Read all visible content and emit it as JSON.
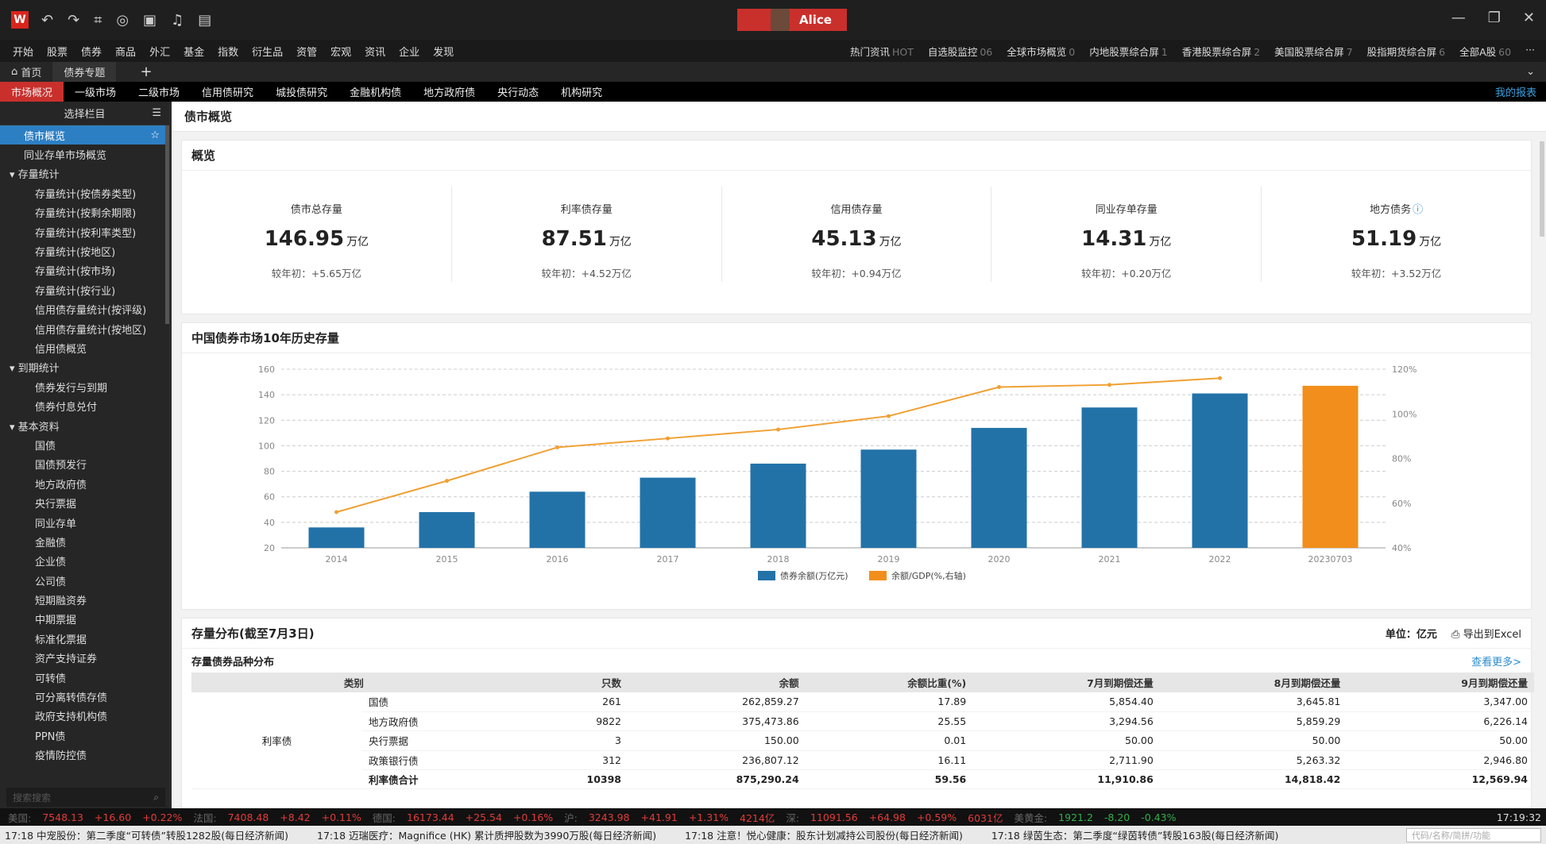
{
  "window": {
    "user_name": "Alice",
    "logo": "W",
    "time": "17:19:32"
  },
  "toolbar_icons": [
    "undo-icon",
    "redo-icon",
    "crop-icon",
    "chat-icon",
    "layout-icon",
    "bell-icon",
    "note-icon"
  ],
  "menu": {
    "left": [
      "开始",
      "股票",
      "债券",
      "商品",
      "外汇",
      "基金",
      "指数",
      "衍生品",
      "资管",
      "宏观",
      "资讯",
      "企业",
      "发现"
    ],
    "right": [
      {
        "label": "热门资讯",
        "badge": "HOT"
      },
      {
        "label": "自选股监控",
        "badge": "06"
      },
      {
        "label": "全球市场概览",
        "badge": "0"
      },
      {
        "label": "内地股票综合屏",
        "badge": "1"
      },
      {
        "label": "香港股票综合屏",
        "badge": "2"
      },
      {
        "label": "美国股票综合屏",
        "badge": "7"
      },
      {
        "label": "股指期货综合屏",
        "badge": "6"
      },
      {
        "label": "全部A股",
        "badge": "60"
      }
    ]
  },
  "tabs": [
    "首页",
    "债券专题"
  ],
  "subnav": {
    "items": [
      "市场概况",
      "一级市场",
      "二级市场",
      "信用债研究",
      "城投债研究",
      "金融机构债",
      "地方政府债",
      "央行动态",
      "机构研究"
    ],
    "right": "我的报表"
  },
  "sidebar": {
    "header": "选择栏目",
    "items": [
      {
        "label": "债市概览",
        "level": "l0",
        "selected": true
      },
      {
        "label": "同业存单市场概览",
        "level": "l0"
      },
      {
        "label": "▾ 存量统计",
        "level": "grp"
      },
      {
        "label": "存量统计(按债券类型)",
        "level": "l1"
      },
      {
        "label": "存量统计(按剩余期限)",
        "level": "l1"
      },
      {
        "label": "存量统计(按利率类型)",
        "level": "l1"
      },
      {
        "label": "存量统计(按地区)",
        "level": "l1"
      },
      {
        "label": "存量统计(按市场)",
        "level": "l1"
      },
      {
        "label": "存量统计(按行业)",
        "level": "l1"
      },
      {
        "label": "信用债存量统计(按评级)",
        "level": "l1"
      },
      {
        "label": "信用债存量统计(按地区)",
        "level": "l1"
      },
      {
        "label": "信用债概览",
        "level": "l1"
      },
      {
        "label": "▾ 到期统计",
        "level": "grp"
      },
      {
        "label": "债券发行与到期",
        "level": "l1"
      },
      {
        "label": "债券付息兑付",
        "level": "l1"
      },
      {
        "label": "▾ 基本资料",
        "level": "grp"
      },
      {
        "label": "国债",
        "level": "l1"
      },
      {
        "label": "国债预发行",
        "level": "l1"
      },
      {
        "label": "地方政府债",
        "level": "l1"
      },
      {
        "label": "央行票据",
        "level": "l1"
      },
      {
        "label": "同业存单",
        "level": "l1"
      },
      {
        "label": "金融债",
        "level": "l1"
      },
      {
        "label": "企业债",
        "level": "l1"
      },
      {
        "label": "公司债",
        "level": "l1"
      },
      {
        "label": "短期融资券",
        "level": "l1"
      },
      {
        "label": "中期票据",
        "level": "l1"
      },
      {
        "label": "标准化票据",
        "level": "l1"
      },
      {
        "label": "资产支持证券",
        "level": "l1"
      },
      {
        "label": "可转债",
        "level": "l1"
      },
      {
        "label": "可分离转债存债",
        "level": "l1"
      },
      {
        "label": "政府支持机构债",
        "level": "l1"
      },
      {
        "label": "PPN债",
        "level": "l1"
      },
      {
        "label": "疫情防控债",
        "level": "l1"
      }
    ],
    "search_placeholder": "搜索搜索"
  },
  "page": {
    "title": "债市概览",
    "overview_title": "概览"
  },
  "kpis": [
    {
      "label": "债市总存量",
      "value": "146.95",
      "unit": "万亿",
      "change": "较年初：+5.65万亿"
    },
    {
      "label": "利率债存量",
      "value": "87.51",
      "unit": "万亿",
      "change": "较年初：+4.52万亿"
    },
    {
      "label": "信用债存量",
      "value": "45.13",
      "unit": "万亿",
      "change": "较年初：+0.94万亿"
    },
    {
      "label": "同业存单存量",
      "value": "14.31",
      "unit": "万亿",
      "change": "较年初：+0.20万亿"
    },
    {
      "label": "地方债务",
      "value": "51.19",
      "unit": "万亿",
      "change": "较年初：+3.52万亿"
    }
  ],
  "chart_title": "中国债券市场10年历史存量",
  "chart_data": {
    "type": "bar",
    "categories": [
      "2014",
      "2015",
      "2016",
      "2017",
      "2018",
      "2019",
      "2020",
      "2021",
      "2022",
      "20230703"
    ],
    "series": [
      {
        "name": "债券余额(万亿元)",
        "type": "bar",
        "axis": "left",
        "values": [
          36,
          48,
          64,
          75,
          86,
          97,
          114,
          130,
          141,
          147
        ],
        "color": "#2272a8",
        "last_color": "#f28e1c"
      },
      {
        "name": "余额/GDP(%,右轴)",
        "type": "line",
        "axis": "right",
        "values": [
          56,
          70,
          85,
          89,
          93,
          99,
          112,
          113,
          116,
          null
        ],
        "color": "#f0a033"
      }
    ],
    "ylim_left": [
      20,
      160
    ],
    "yticks_left": [
      20,
      40,
      60,
      80,
      100,
      120,
      140,
      160
    ],
    "ylim_right": [
      40,
      120
    ],
    "yticks_right": [
      "40%",
      "60%",
      "80%",
      "100%",
      "120%"
    ],
    "grid": true,
    "legend": "bottom"
  },
  "dist": {
    "title": "存量分布(截至7月3日)",
    "unit_label": "单位：亿元",
    "export_label": "导出到Excel",
    "subtitle": "存量债券品种分布",
    "more_label": "查看更多>",
    "columns": [
      "类别",
      "只数",
      "余额",
      "余额比重(%)",
      "7月到期偿还量",
      "8月到期偿还量",
      "9月到期偿还量"
    ],
    "group": "利率债",
    "rows": [
      [
        "国债",
        "261",
        "262,859.27",
        "17.89",
        "5,854.40",
        "3,645.81",
        "3,347.00"
      ],
      [
        "地方政府债",
        "9822",
        "375,473.86",
        "25.55",
        "3,294.56",
        "5,859.29",
        "6,226.14"
      ],
      [
        "央行票据",
        "3",
        "150.00",
        "0.01",
        "50.00",
        "50.00",
        "50.00"
      ],
      [
        "政策银行债",
        "312",
        "236,807.12",
        "16.11",
        "2,711.90",
        "5,263.32",
        "2,946.80"
      ],
      [
        "利率债合计",
        "10398",
        "875,290.24",
        "59.56",
        "11,910.86",
        "14,818.42",
        "12,569.94"
      ]
    ]
  },
  "status": [
    {
      "t": "美国:",
      "c": "g"
    },
    {
      "t": "7548.13",
      "c": "r"
    },
    {
      "t": "+16.60",
      "c": "r"
    },
    {
      "t": "+0.22%",
      "c": "r"
    },
    {
      "t": "法国:",
      "c": "g"
    },
    {
      "t": "7408.48",
      "c": "r"
    },
    {
      "t": "+8.42",
      "c": "r"
    },
    {
      "t": "+0.11%",
      "c": "r"
    },
    {
      "t": "德国:",
      "c": "g"
    },
    {
      "t": "16173.44",
      "c": "r"
    },
    {
      "t": "+25.54",
      "c": "r"
    },
    {
      "t": "+0.16%",
      "c": "r"
    },
    {
      "t": "沪:",
      "c": "g"
    },
    {
      "t": "3243.98",
      "c": "r"
    },
    {
      "t": "+41.91",
      "c": "r"
    },
    {
      "t": "+1.31%",
      "c": "r"
    },
    {
      "t": "4214亿",
      "c": "r"
    },
    {
      "t": "深:",
      "c": "g"
    },
    {
      "t": "11091.56",
      "c": "r"
    },
    {
      "t": "+64.98",
      "c": "r"
    },
    {
      "t": "+0.59%",
      "c": "r"
    },
    {
      "t": "6031亿",
      "c": "r"
    },
    {
      "t": "美黄金:",
      "c": "g"
    },
    {
      "t": "1921.2",
      "c": "gr"
    },
    {
      "t": "-8.20",
      "c": "gr"
    },
    {
      "t": "-0.43%",
      "c": "gr"
    }
  ],
  "ticker": [
    "17:18 中宠股份：第二季度“可转债”转股1282股(每日经济新闻)",
    "17:18 迈瑞医疗：Magnifice (HK) 累计质押股数为3990万股(每日经济新闻)",
    "17:18 注意！悦心健康：股东计划减持公司股份(每日经济新闻)",
    "17:18 绿茵生态：第二季度“绿茵转债”转股163股(每日经济新闻)"
  ],
  "ticker_placeholder": "代码/名称/简拼/功能"
}
